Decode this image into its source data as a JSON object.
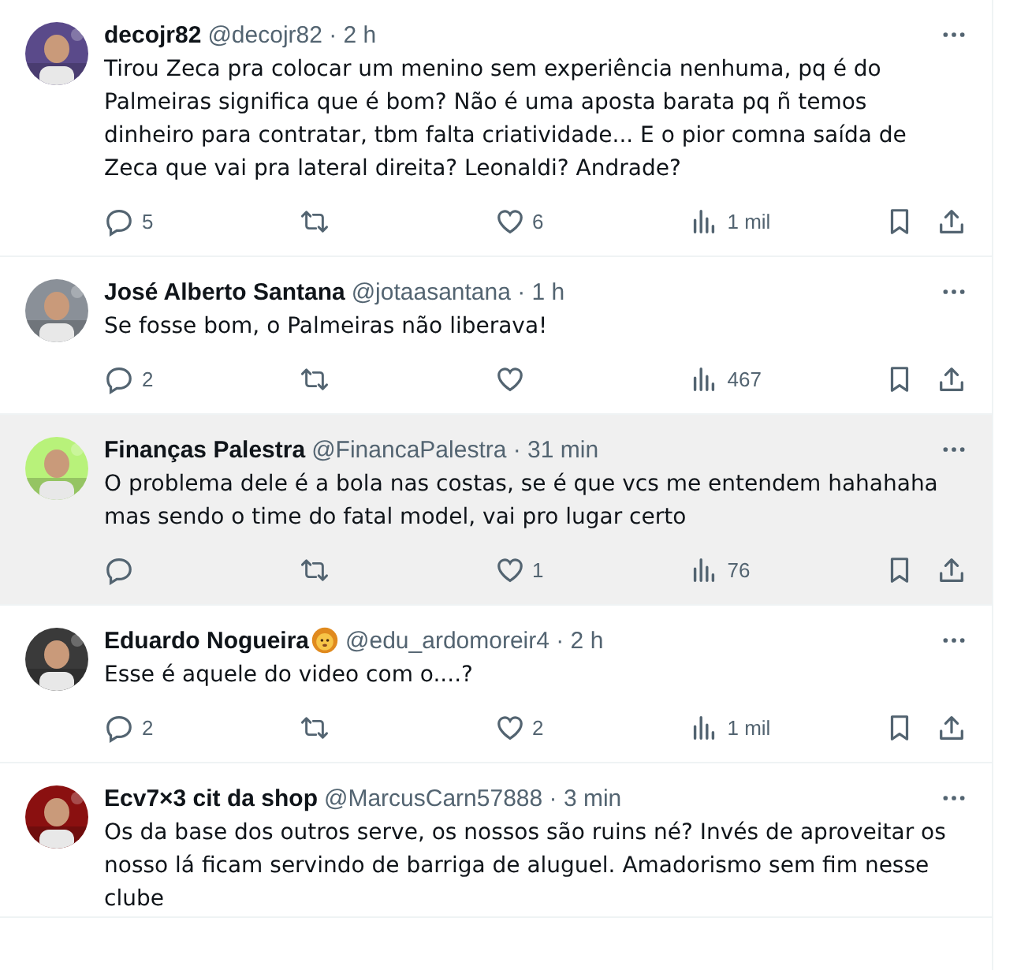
{
  "posts": [
    {
      "name": "decojr82",
      "meta": "@decojr82 · 2 h",
      "highlighted": false,
      "text": "Tirou Zeca pra colocar um menino sem experiência nenhuma, pq é do Palmeiras significa que é bom? Não é uma aposta barata pq ñ temos dinheiro para contratar, tbm falta criatividade... E o pior comna saída de Zeca que vai pra lateral direita? Leonaldi? Andrade?",
      "replies": "5",
      "likes": "6",
      "views": "1 mil"
    },
    {
      "name": "José Alberto Santana",
      "meta": "@jotaasantana · 1 h",
      "highlighted": false,
      "text": "Se fosse bom, o Palmeiras não liberava!",
      "replies": "2",
      "views": "467"
    },
    {
      "name": "Finanças Palestra",
      "meta": "@FinancaPalestra · 31 min",
      "highlighted": true,
      "text": "O problema dele é a bola nas costas, se é que vcs me entendem hahahaha mas sendo o time do fatal model, vai pro lugar certo",
      "likes": "1",
      "views": "76"
    },
    {
      "name": "Eduardo Nogueira",
      "badge": {
        "kind": "lion"
      },
      "meta": "@edu_ardomoreir4 · 2 h",
      "highlighted": false,
      "text": "Esse é aquele do video com o....?",
      "replies": "2",
      "likes": "2",
      "views": "1 mil"
    },
    {
      "name": "Ecv7×3 cit da shop",
      "meta": "@MarcusCarn57888 · 3 min",
      "highlighted": false,
      "text": "Os da base dos outros serve, os nossos são ruins né? Invés de aproveitar os nosso lá ficam servindo de barriga de aluguel. Amadorismo sem fim nesse clube"
    }
  ]
}
